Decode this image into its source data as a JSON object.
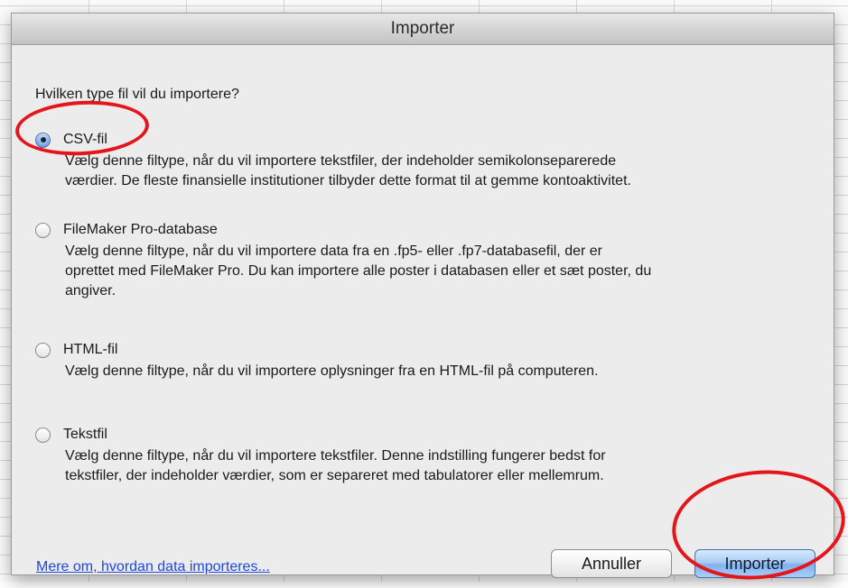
{
  "window": {
    "title": "Importer"
  },
  "dialog": {
    "question": "Hvilken type fil vil du importere?",
    "options": [
      {
        "label": "CSV-fil",
        "selected": true,
        "description": [
          "Vælg denne filtype, når du vil importere tekstfiler, der indeholder semikolonseparerede",
          "værdier. De fleste finansielle institutioner tilbyder dette format til at gemme kontoaktivitet."
        ]
      },
      {
        "label": "FileMaker Pro-database",
        "selected": false,
        "description": [
          "Vælg denne filtype, når du vil importere data fra en .fp5- eller .fp7-databasefil, der er",
          "oprettet med FileMaker Pro. Du kan importere alle poster i databasen eller et sæt poster, du",
          "angiver."
        ]
      },
      {
        "label": "HTML-fil",
        "selected": false,
        "description": [
          "Vælg denne filtype, når du vil importere oplysninger fra en HTML-fil på computeren."
        ]
      },
      {
        "label": "Tekstfil",
        "selected": false,
        "description": [
          "Vælg denne filtype, når du vil importere tekstfiler. Denne indstilling fungerer bedst for",
          "tekstfiler, der indeholder værdier, som er separeret med tabulatorer eller mellemrum."
        ]
      }
    ],
    "help_link": "Mere om, hvordan data importeres...",
    "buttons": {
      "cancel": "Annuller",
      "import": "Importer"
    }
  },
  "colors": {
    "annotation": "#e4151b",
    "link": "#1f47d9",
    "default_button": "#7fb1ee"
  }
}
